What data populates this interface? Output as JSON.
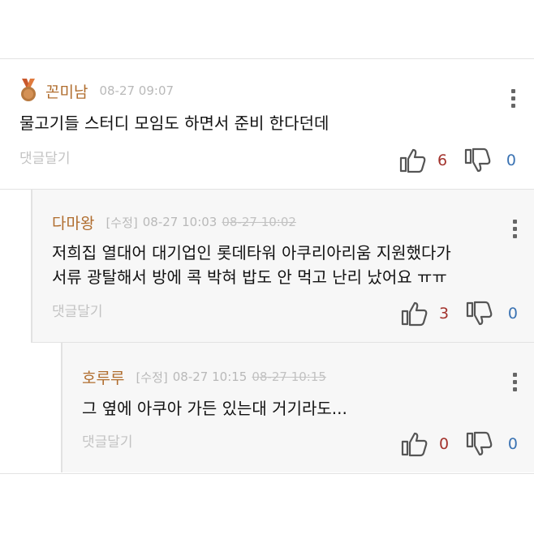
{
  "comments": [
    {
      "nickname": "꼰미남",
      "edited_label": "",
      "time": "08-27 09:07",
      "original_time": "",
      "lines": [
        "물고기들 스터디 모임도 하면서 준비 한다던데"
      ],
      "reply_label": "댓글달기",
      "likes": "6",
      "dislikes": "0",
      "badge_icon": "bronze-medal-icon"
    },
    {
      "nickname": "다마왕",
      "edited_label": "[수정]",
      "time": "08-27 10:03",
      "original_time": "08-27 10:02",
      "lines": [
        "저희집 열대어 대기업인 롯데타워 아쿠리아리움 지원했다가",
        "서류 광탈해서 방에 콕 박혀 밥도 안 먹고 난리 났어요 ㅠㅠ"
      ],
      "reply_label": "댓글달기",
      "likes": "3",
      "dislikes": "0"
    },
    {
      "nickname": "호루루",
      "edited_label": "[수정]",
      "time": "08-27 10:15",
      "original_time": "08-27 10:15",
      "lines": [
        "그 옆에 아쿠아 가든 있는대 거기라도..."
      ],
      "reply_label": "댓글달기",
      "likes": "0",
      "dislikes": "0"
    }
  ],
  "colors": {
    "nickname": "#b06d2e",
    "likes": "#a3332d",
    "dislikes": "#3b73b3",
    "muted": "#b9b9b9"
  },
  "icons": {
    "thumbs_up": "thumbs-up-icon",
    "thumbs_down": "thumbs-down-icon",
    "more": "more-vertical-icon"
  }
}
